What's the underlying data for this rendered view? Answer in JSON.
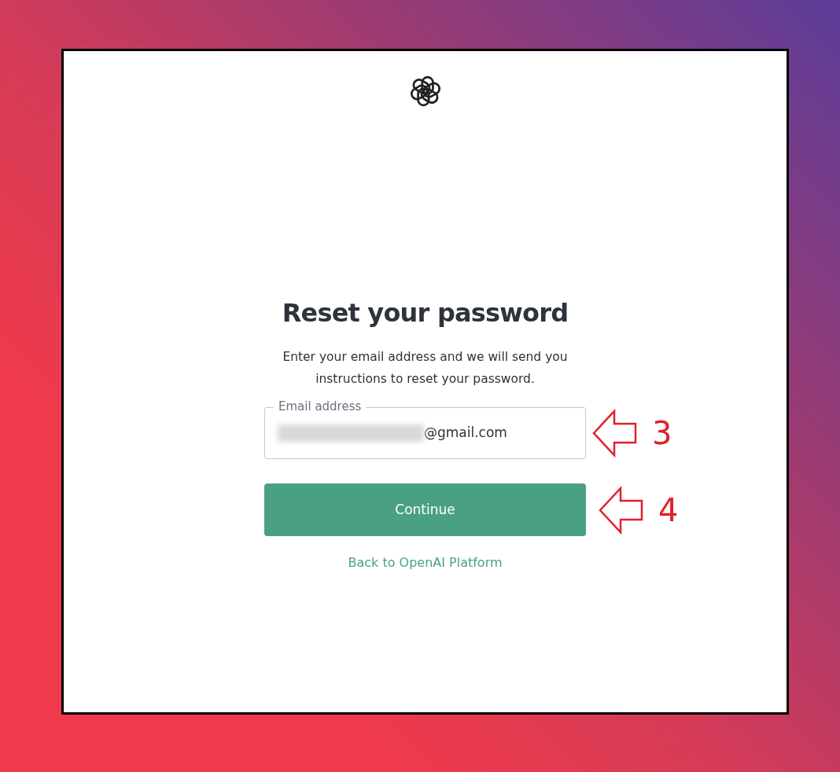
{
  "page": {
    "title": "Reset your password",
    "description": "Enter your email address and we will send you instructions to reset your password."
  },
  "email_field": {
    "label": "Email address",
    "value": "@gmail.com",
    "redacted": true,
    "annotation": "3"
  },
  "continue_button": {
    "label": "Continue",
    "annotation": "4"
  },
  "back_link": {
    "label": "Back to OpenAI Platform"
  }
}
